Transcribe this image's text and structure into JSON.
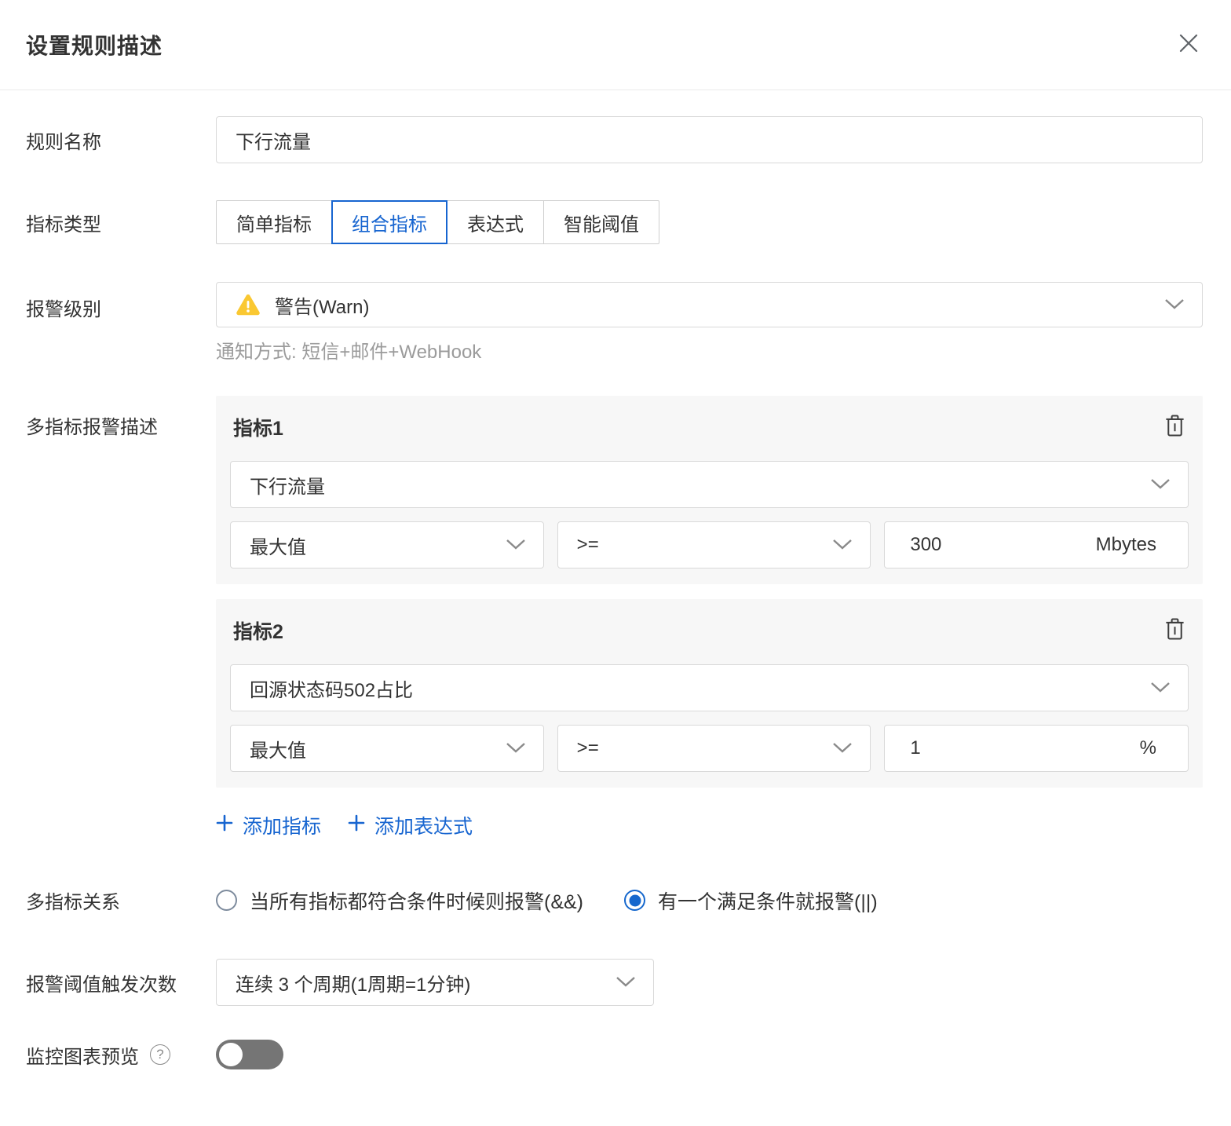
{
  "dialog": {
    "title": "设置规则描述"
  },
  "form": {
    "rule_name": {
      "label": "规则名称",
      "value": "下行流量"
    },
    "metric_type": {
      "label": "指标类型",
      "options": [
        "简单指标",
        "组合指标",
        "表达式",
        "智能阈值"
      ],
      "selected": "组合指标"
    },
    "alarm_level": {
      "label": "报警级别",
      "value": "警告(Warn)",
      "notify": "通知方式: 短信+邮件+WebHook"
    },
    "multi_metric": {
      "label": "多指标报警描述",
      "metrics": [
        {
          "title": "指标1",
          "metric": "下行流量",
          "aggregation": "最大值",
          "operator": ">=",
          "value": "300",
          "unit": "Mbytes"
        },
        {
          "title": "指标2",
          "metric": "回源状态码502占比",
          "aggregation": "最大值",
          "operator": ">=",
          "value": "1",
          "unit": "%"
        }
      ],
      "add_metric": "添加指标",
      "add_expression": "添加表达式"
    },
    "relation": {
      "label": "多指标关系",
      "options": [
        {
          "label": "当所有指标都符合条件时候则报警(&&)",
          "selected": false
        },
        {
          "label": "有一个满足条件就报警(||)",
          "selected": true
        }
      ]
    },
    "trigger": {
      "label": "报警阈值触发次数",
      "value": "连续 3 个周期(1周期=1分钟)"
    },
    "preview": {
      "label": "监控图表预览",
      "enabled": false
    }
  },
  "colors": {
    "accent": "#1765d0",
    "warning": "#fac832"
  }
}
